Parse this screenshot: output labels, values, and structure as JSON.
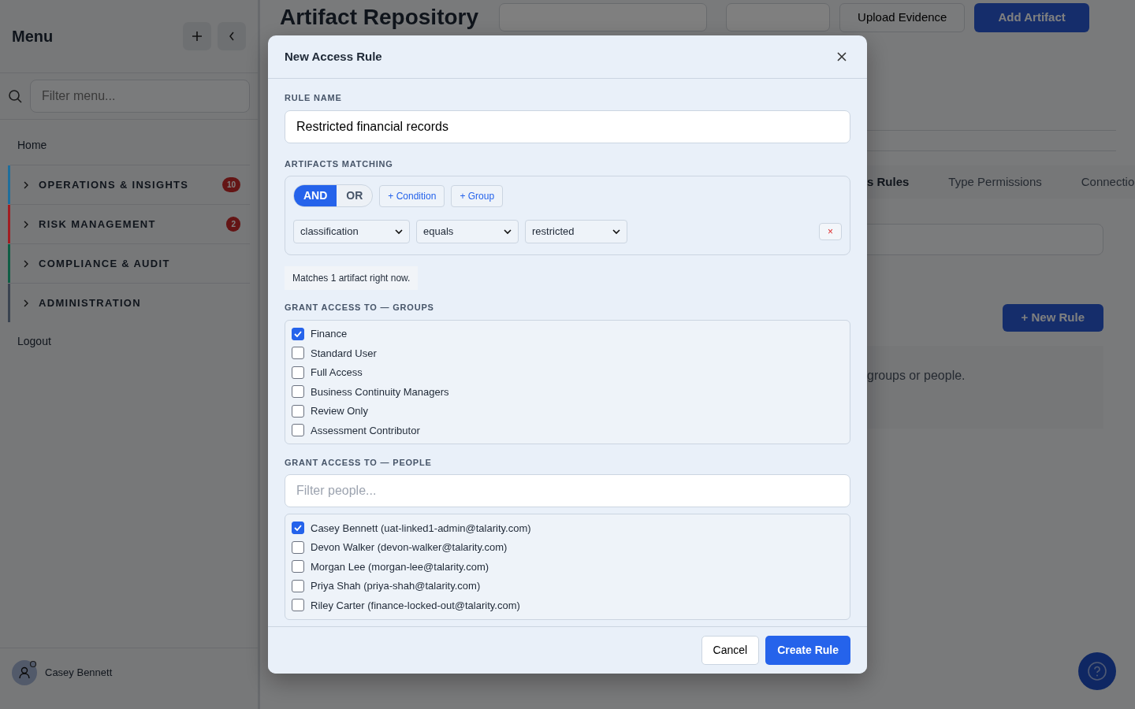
{
  "sidebar": {
    "title": "Menu",
    "filter": {
      "placeholder": "Filter menu..."
    },
    "items": [
      {
        "kind": "link",
        "label": "Home"
      },
      {
        "kind": "section",
        "label": "OPERATIONS & INSIGHTS",
        "color": "#1f6e9c",
        "badge": "10",
        "expanded": false
      },
      {
        "kind": "section",
        "label": "RISK MANAGEMENT",
        "color": "#a11d22",
        "badge": "2",
        "expanded": false
      },
      {
        "kind": "section",
        "label": "COMPLIANCE & AUDIT",
        "color": "#0f5d44",
        "expanded": false
      },
      {
        "kind": "section",
        "label": "ADMINISTRATION",
        "color": "#3a4350",
        "expanded": false
      },
      {
        "kind": "link",
        "label": "Logout"
      }
    ],
    "user": {
      "name": "Casey Bennett"
    }
  },
  "main": {
    "title": "Artifact Repository",
    "buttons": [
      {
        "label": "Upload Evidence",
        "kind": "outline"
      },
      {
        "label": "Add Artifact",
        "kind": "primary"
      }
    ],
    "tabs": [
      {
        "label": "s Rules",
        "selected": true
      },
      {
        "label": "Type Permissions",
        "selected": false
      },
      {
        "label": "Connectio",
        "selected": false
      }
    ],
    "new_rule": "+ New Rule",
    "empty_text": "groups or people."
  },
  "modal": {
    "title": "New Access Rule",
    "rule_name": {
      "label": "RULE NAME",
      "value": "Restricted financial records"
    },
    "matching": {
      "label": "ARTIFACTS MATCHING",
      "logic": [
        {
          "label": "AND",
          "selected": true
        },
        {
          "label": "OR",
          "selected": false
        }
      ],
      "add_buttons": [
        "+ Condition",
        "+ Group"
      ],
      "conditions": [
        {
          "field": "classification",
          "operator": "equals",
          "value": "restricted",
          "remove": "×"
        }
      ],
      "note": "Matches 1 artifact right now."
    },
    "groups": {
      "label": "GRANT ACCESS TO — GROUPS",
      "items": [
        {
          "label": "Finance",
          "checked": true
        },
        {
          "label": "Standard User",
          "checked": false
        },
        {
          "label": "Full Access",
          "checked": false
        },
        {
          "label": "Business Continuity Managers",
          "checked": false
        },
        {
          "label": "Review Only",
          "checked": false
        },
        {
          "label": "Assessment Contributor",
          "checked": false
        }
      ]
    },
    "people": {
      "label": "GRANT ACCESS TO — PEOPLE",
      "filter": {
        "placeholder": "Filter people..."
      },
      "items": [
        {
          "label": "Casey Bennett (uat-linked1-admin@talarity.com)",
          "checked": true
        },
        {
          "label": "Devon Walker (devon-walker@talarity.com)",
          "checked": false
        },
        {
          "label": "Morgan Lee (morgan-lee@talarity.com)",
          "checked": false
        },
        {
          "label": "Priya Shah (priya-shah@talarity.com)",
          "checked": false
        },
        {
          "label": "Riley Carter (finance-locked-out@talarity.com)",
          "checked": false
        }
      ]
    },
    "buttons": [
      {
        "label": "Cancel",
        "kind": "secondary"
      },
      {
        "label": "Create Rule",
        "kind": "primary"
      }
    ]
  }
}
